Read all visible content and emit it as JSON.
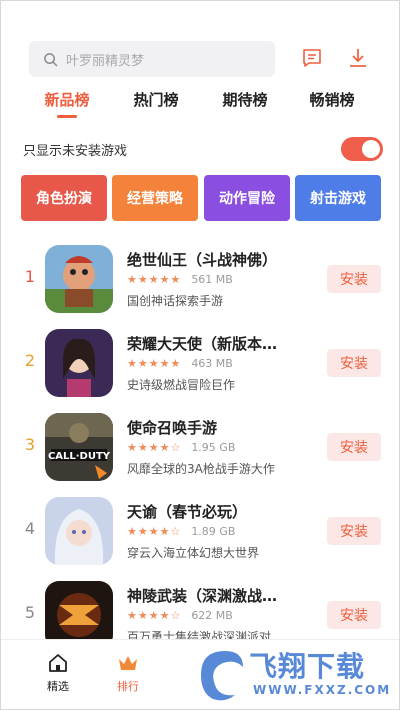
{
  "search": {
    "placeholder": "叶罗丽精灵梦"
  },
  "header_icons": [
    "message-icon",
    "download-icon"
  ],
  "tabs": [
    {
      "label": "新品榜",
      "active": true
    },
    {
      "label": "热门榜",
      "active": false
    },
    {
      "label": "期待榜",
      "active": false
    },
    {
      "label": "畅销榜",
      "active": false
    }
  ],
  "filter": {
    "label": "只显示未安装游戏",
    "enabled": true
  },
  "categories": [
    {
      "label": "角色扮演",
      "color": "#e8584a"
    },
    {
      "label": "经营策略",
      "color": "#f4823a"
    },
    {
      "label": "动作冒险",
      "color": "#8a4fe0"
    },
    {
      "label": "射击游戏",
      "color": "#4e7de8"
    }
  ],
  "apps": [
    {
      "rank": "1",
      "rank_color": "#e8584a",
      "name": "绝世仙王（斗战神佛）",
      "rating": 4.5,
      "size": "561 MB",
      "desc": "国创神话探索手游",
      "button": "安装"
    },
    {
      "rank": "2",
      "rank_color": "#e5a12a",
      "name": "荣耀大天使（新版本…",
      "rating": 4.5,
      "size": "463 MB",
      "desc": "史诗级燃战冒险巨作",
      "button": "安装"
    },
    {
      "rank": "3",
      "rank_color": "#e5a12a",
      "name": "使命召唤手游",
      "rating": 4,
      "size": "1.95 GB",
      "desc": "风靡全球的3A枪战手游大作",
      "button": "安装"
    },
    {
      "rank": "4",
      "rank_color": "#888888",
      "name": "天谕（春节必玩）",
      "rating": 4,
      "size": "1.89 GB",
      "desc": "穿云入海立体幻想大世界",
      "button": "安装"
    },
    {
      "rank": "5",
      "rank_color": "#888888",
      "name": "神陵武装（深渊激战…",
      "rating": 4,
      "size": "622 MB",
      "desc": "百万勇士集结激战深渊派对",
      "button": "安装"
    }
  ],
  "bottom_nav": [
    {
      "label": "精选",
      "icon": "home-icon",
      "active": false
    },
    {
      "label": "排行",
      "icon": "crown-icon",
      "active": true
    }
  ],
  "watermark": {
    "title": "飞翔下载",
    "sub": "WWW.FXXZ.COM"
  }
}
